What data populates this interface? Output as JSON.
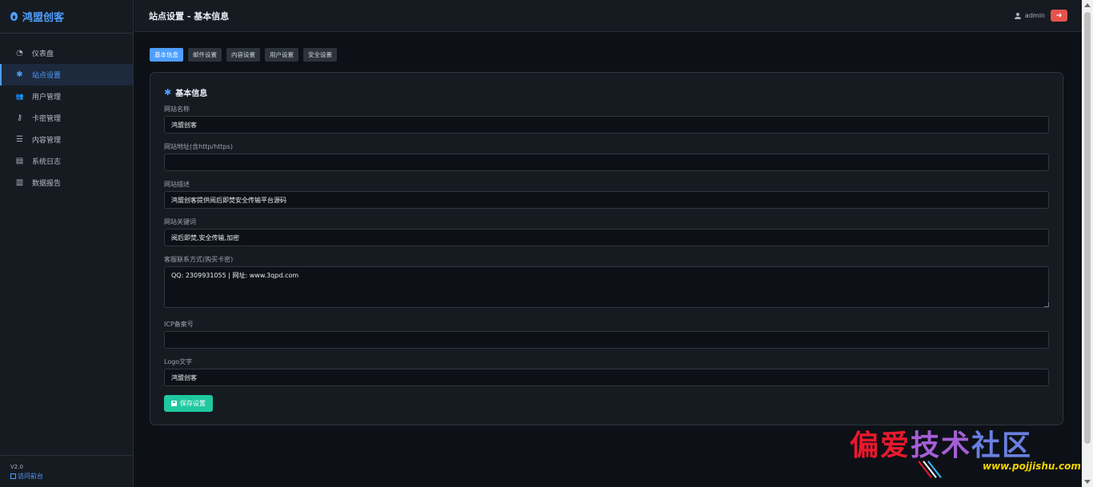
{
  "brand": {
    "name": "鸿盟创客"
  },
  "sidebar": {
    "items": [
      {
        "label": "仪表盘",
        "icon": "dashboard-icon",
        "glyph": "◔"
      },
      {
        "label": "站点设置",
        "icon": "gear-icon",
        "glyph": "✱"
      },
      {
        "label": "用户管理",
        "icon": "users-icon",
        "glyph": "👥"
      },
      {
        "label": "卡密管理",
        "icon": "key-icon",
        "glyph": "⚷"
      },
      {
        "label": "内容管理",
        "icon": "database-icon",
        "glyph": "☰"
      },
      {
        "label": "系统日志",
        "icon": "clipboard-icon",
        "glyph": "▤"
      },
      {
        "label": "数据报告",
        "icon": "file-icon",
        "glyph": "▥"
      }
    ],
    "active_index": 1,
    "version": "V2.0",
    "front_link": "访问前台"
  },
  "header": {
    "title": "站点设置 - 基本信息",
    "username": "admin"
  },
  "tabs": [
    {
      "label": "基本信息",
      "active": true
    },
    {
      "label": "邮件设置",
      "active": false
    },
    {
      "label": "内容设置",
      "active": false
    },
    {
      "label": "用户设置",
      "active": false
    },
    {
      "label": "安全设置",
      "active": false
    }
  ],
  "form": {
    "section_title": "基本信息",
    "fields": {
      "site_name": {
        "label": "网站名称",
        "value": "鸿盟创客"
      },
      "site_url": {
        "label": "网站地址(含http/https)",
        "value": ""
      },
      "site_desc": {
        "label": "网站描述",
        "value": "鸿盟创客提供阅后即焚安全传输平台源码"
      },
      "site_keywords": {
        "label": "网站关键词",
        "value": "阅后即焚,安全传输,加密"
      },
      "contact": {
        "label": "客服联系方式(购买卡密)",
        "value": "QQ: 2309931055 | 网址: www.3qpd.com"
      },
      "icp": {
        "label": "ICP备案号",
        "value": ""
      },
      "logo_text": {
        "label": "Logo文字",
        "value": "鸿盟创客"
      }
    },
    "save_label": "保存设置"
  },
  "watermark": {
    "text": "偏爱技术社区",
    "url": "www.pojjishu.com"
  },
  "colors": {
    "accent": "#4e9eff",
    "danger": "#e5534b",
    "success": "#1fc8a0",
    "background": "#0d1117",
    "panel": "#161b22"
  }
}
